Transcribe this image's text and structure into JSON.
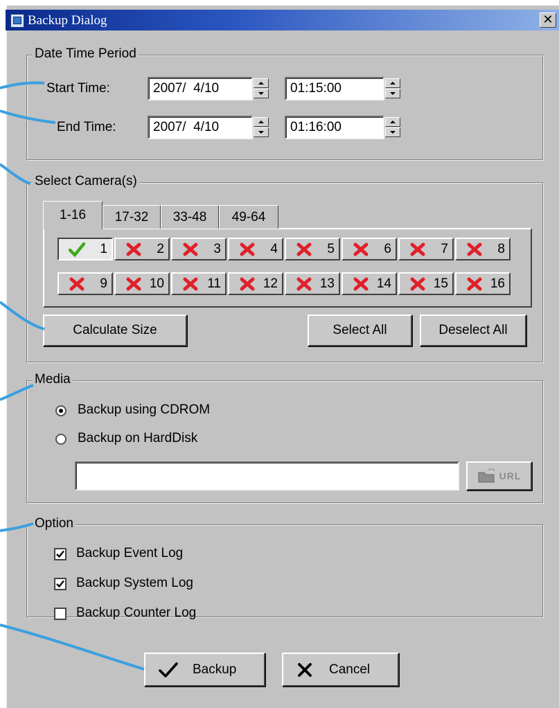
{
  "window": {
    "title": "Backup Dialog",
    "close_glyph": "✕"
  },
  "date_time_period": {
    "legend": "Date Time Period",
    "start_label": "Start Time:",
    "start_date": "2007/  4/10",
    "start_time": "01:15:00",
    "end_label": "End Time:",
    "end_date": "2007/  4/10",
    "end_time": "01:16:00"
  },
  "select_cameras": {
    "legend": "Select Camera(s)",
    "tabs": [
      "1-16",
      "17-32",
      "33-48",
      "49-64"
    ],
    "active_tab": "1-16",
    "cameras": [
      {
        "label": "1",
        "selected": true
      },
      {
        "label": "2",
        "selected": false
      },
      {
        "label": "3",
        "selected": false
      },
      {
        "label": "4",
        "selected": false
      },
      {
        "label": "5",
        "selected": false
      },
      {
        "label": "6",
        "selected": false
      },
      {
        "label": "7",
        "selected": false
      },
      {
        "label": "8",
        "selected": false
      },
      {
        "label": "9",
        "selected": false
      },
      {
        "label": "10",
        "selected": false
      },
      {
        "label": "11",
        "selected": false
      },
      {
        "label": "12",
        "selected": false
      },
      {
        "label": "13",
        "selected": false
      },
      {
        "label": "14",
        "selected": false
      },
      {
        "label": "15",
        "selected": false
      },
      {
        "label": "16",
        "selected": false
      }
    ],
    "calculate_size": "Calculate Size",
    "select_all": "Select All",
    "deselect_all": "Deselect All"
  },
  "media": {
    "legend": "Media",
    "option_cdrom": "Backup using CDROM",
    "option_harddisk": "Backup on HardDisk",
    "selected": "cdrom",
    "path_value": "",
    "url_button": "URL"
  },
  "option": {
    "legend": "Option",
    "event_log": "Backup Event Log",
    "event_log_checked": true,
    "system_log": "Backup System Log",
    "system_log_checked": true,
    "counter_log": "Backup Counter Log",
    "counter_log_checked": false
  },
  "footer": {
    "backup": "Backup",
    "cancel": "Cancel"
  },
  "colors": {
    "callout": "#3aa0e0",
    "dialog_bg": "#c2c2c2",
    "check_green": "#3caa1e",
    "x_red": "#e0202a"
  }
}
